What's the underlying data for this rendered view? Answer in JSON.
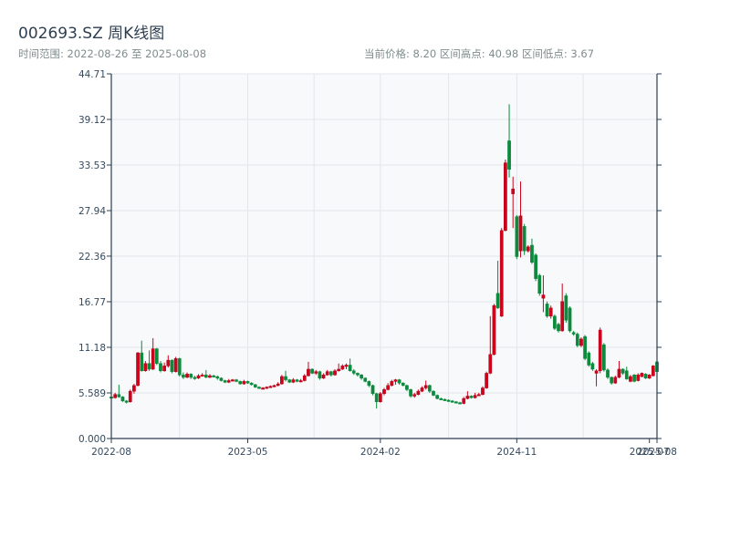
{
  "header": {
    "title": "002693.SZ 周K线图",
    "range": "时间范围: 2022-08-26 至 2025-08-08",
    "stats": "当前价格: 8.20  区间高点: 40.98  区间低点: 3.67"
  },
  "colors": {
    "up": "#d0021b",
    "down": "#0b8a3c",
    "plot_bg": "#f7f9fb",
    "grid": "#e3e6ea",
    "axis": "#2c3e50"
  },
  "chart_data": {
    "type": "candlestick",
    "title": "002693.SZ 周K线图",
    "ylim": [
      0,
      44.71
    ],
    "y_ticks": [
      "0.000",
      "5.589",
      "11.18",
      "16.77",
      "22.36",
      "27.94",
      "33.53",
      "39.12",
      "44.71"
    ],
    "x_ticks": [
      {
        "label": "2022-08",
        "index": 0
      },
      {
        "label": "2023-05",
        "index": 36
      },
      {
        "label": "2024-02",
        "index": 71
      },
      {
        "label": "2024-11",
        "index": 107
      },
      {
        "label": "2025-07",
        "index": 142
      },
      {
        "label": "2025-08",
        "index": 144
      }
    ],
    "grid": true,
    "candle_fields": [
      "open",
      "close",
      "low",
      "high"
    ],
    "candles": [
      [
        5.1,
        5.0,
        4.9,
        5.3
      ],
      [
        5.0,
        5.4,
        4.9,
        5.6
      ],
      [
        5.4,
        5.1,
        5.0,
        6.6
      ],
      [
        5.1,
        4.6,
        4.5,
        5.2
      ],
      [
        4.6,
        4.5,
        4.3,
        4.7
      ],
      [
        4.5,
        5.8,
        4.4,
        6.0
      ],
      [
        5.8,
        6.5,
        5.5,
        6.7
      ],
      [
        6.5,
        10.5,
        6.4,
        10.6
      ],
      [
        10.5,
        8.3,
        8.2,
        12.0
      ],
      [
        8.3,
        9.2,
        8.2,
        9.5
      ],
      [
        9.2,
        8.5,
        8.3,
        10.8
      ],
      [
        8.5,
        11.0,
        8.4,
        12.3
      ],
      [
        11.0,
        9.2,
        9.0,
        11.1
      ],
      [
        9.2,
        8.3,
        8.1,
        9.5
      ],
      [
        8.3,
        8.9,
        8.2,
        9.3
      ],
      [
        8.9,
        9.6,
        8.7,
        10.2
      ],
      [
        9.6,
        8.2,
        8.0,
        9.7
      ],
      [
        8.2,
        9.8,
        8.1,
        10.0
      ],
      [
        9.8,
        7.8,
        7.6,
        9.9
      ],
      [
        7.8,
        7.5,
        7.3,
        8.1
      ],
      [
        7.5,
        7.9,
        7.4,
        8.1
      ],
      [
        7.9,
        7.5,
        7.3,
        8.0
      ],
      [
        7.5,
        7.4,
        7.2,
        7.7
      ],
      [
        7.4,
        7.7,
        7.3,
        7.9
      ],
      [
        7.7,
        7.8,
        7.6,
        8.0
      ],
      [
        7.8,
        7.5,
        7.4,
        8.4
      ],
      [
        7.5,
        7.7,
        7.4,
        7.9
      ],
      [
        7.7,
        7.6,
        7.5,
        7.8
      ],
      [
        7.6,
        7.4,
        7.2,
        7.7
      ],
      [
        7.4,
        7.1,
        7.0,
        7.5
      ],
      [
        7.1,
        6.9,
        6.8,
        7.2
      ],
      [
        6.9,
        7.1,
        6.8,
        7.3
      ],
      [
        7.1,
        7.2,
        7.0,
        7.3
      ],
      [
        7.2,
        7.0,
        6.9,
        7.3
      ],
      [
        7.0,
        6.7,
        6.6,
        7.1
      ],
      [
        6.7,
        7.0,
        6.6,
        7.2
      ],
      [
        7.0,
        6.8,
        6.7,
        7.1
      ],
      [
        6.8,
        6.6,
        6.5,
        6.9
      ],
      [
        6.6,
        6.3,
        6.2,
        6.7
      ],
      [
        6.3,
        6.2,
        6.1,
        6.4
      ],
      [
        6.2,
        6.2,
        6.1,
        6.3
      ],
      [
        6.2,
        6.3,
        6.1,
        6.4
      ],
      [
        6.3,
        6.4,
        6.2,
        6.5
      ],
      [
        6.4,
        6.5,
        6.3,
        6.6
      ],
      [
        6.5,
        6.7,
        6.4,
        6.9
      ],
      [
        6.7,
        7.6,
        6.6,
        7.8
      ],
      [
        7.6,
        7.2,
        7.0,
        8.3
      ],
      [
        7.2,
        6.9,
        6.8,
        7.3
      ],
      [
        6.9,
        7.2,
        6.8,
        7.4
      ],
      [
        7.2,
        7.0,
        6.9,
        7.3
      ],
      [
        7.0,
        7.1,
        6.9,
        7.3
      ],
      [
        7.1,
        7.7,
        7.0,
        7.9
      ],
      [
        7.7,
        8.5,
        7.6,
        9.4
      ],
      [
        8.5,
        8.0,
        7.9,
        8.6
      ],
      [
        8.0,
        8.2,
        7.8,
        8.4
      ],
      [
        8.2,
        7.4,
        7.2,
        8.3
      ],
      [
        7.4,
        7.8,
        7.3,
        8.0
      ],
      [
        7.8,
        8.2,
        7.7,
        8.4
      ],
      [
        8.2,
        7.8,
        7.6,
        8.3
      ],
      [
        7.8,
        8.3,
        7.7,
        8.5
      ],
      [
        8.3,
        8.5,
        8.2,
        9.2
      ],
      [
        8.5,
        8.9,
        8.4,
        9.1
      ],
      [
        8.9,
        9.0,
        8.5,
        9.2
      ],
      [
        9.0,
        8.3,
        8.2,
        9.8
      ],
      [
        8.3,
        8.0,
        7.8,
        8.5
      ],
      [
        8.0,
        7.8,
        7.6,
        8.1
      ],
      [
        7.8,
        7.4,
        7.2,
        7.9
      ],
      [
        7.4,
        7.0,
        6.9,
        7.5
      ],
      [
        7.0,
        6.5,
        6.3,
        7.1
      ],
      [
        6.5,
        5.5,
        5.3,
        6.6
      ],
      [
        5.5,
        4.5,
        3.67,
        5.6
      ],
      [
        4.5,
        5.5,
        4.4,
        5.7
      ],
      [
        5.5,
        6.0,
        5.3,
        6.2
      ],
      [
        6.0,
        6.5,
        5.9,
        6.8
      ],
      [
        6.5,
        7.0,
        6.4,
        7.2
      ],
      [
        7.0,
        7.2,
        6.6,
        7.3
      ],
      [
        7.2,
        6.8,
        6.6,
        7.3
      ],
      [
        6.8,
        6.5,
        6.4,
        6.9
      ],
      [
        6.5,
        6.0,
        5.8,
        6.6
      ],
      [
        6.0,
        5.2,
        5.0,
        6.1
      ],
      [
        5.2,
        5.4,
        5.0,
        5.6
      ],
      [
        5.4,
        5.8,
        5.3,
        6.0
      ],
      [
        5.8,
        6.2,
        5.7,
        6.4
      ],
      [
        6.2,
        6.5,
        6.0,
        7.1
      ],
      [
        6.5,
        5.8,
        5.6,
        6.6
      ],
      [
        5.8,
        5.3,
        5.2,
        5.9
      ],
      [
        5.3,
        4.9,
        4.8,
        5.4
      ],
      [
        4.9,
        4.8,
        4.7,
        5.0
      ],
      [
        4.8,
        4.7,
        4.6,
        4.9
      ],
      [
        4.7,
        4.6,
        4.5,
        4.8
      ],
      [
        4.6,
        4.5,
        4.4,
        4.7
      ],
      [
        4.5,
        4.4,
        4.3,
        4.6
      ],
      [
        4.4,
        4.3,
        4.2,
        4.5
      ],
      [
        4.3,
        4.9,
        4.2,
        5.1
      ],
      [
        4.9,
        5.2,
        4.8,
        5.8
      ],
      [
        5.2,
        5.0,
        4.9,
        5.3
      ],
      [
        5.0,
        5.3,
        4.9,
        5.6
      ],
      [
        5.3,
        5.4,
        5.2,
        5.6
      ],
      [
        5.4,
        6.2,
        5.3,
        6.4
      ],
      [
        6.2,
        8.0,
        6.1,
        8.2
      ],
      [
        8.0,
        10.3,
        7.9,
        15.0
      ],
      [
        10.3,
        16.3,
        10.2,
        16.5
      ],
      [
        17.8,
        16.0,
        15.9,
        21.8
      ],
      [
        15.0,
        25.5,
        14.9,
        25.8
      ],
      [
        25.5,
        33.8,
        25.4,
        34.2
      ],
      [
        36.5,
        33.0,
        32.0,
        40.98
      ],
      [
        30.0,
        30.6,
        25.8,
        32.1
      ],
      [
        27.2,
        22.3,
        22.0,
        27.4
      ],
      [
        23.0,
        27.3,
        22.2,
        31.5
      ],
      [
        26.0,
        23.0,
        22.5,
        26.3
      ],
      [
        23.0,
        23.5,
        22.8,
        23.7
      ],
      [
        23.7,
        21.6,
        21.4,
        24.5
      ],
      [
        22.5,
        19.6,
        19.3,
        22.7
      ],
      [
        20.0,
        17.8,
        17.5,
        20.2
      ],
      [
        17.2,
        17.6,
        15.5,
        20.0
      ],
      [
        16.5,
        15.0,
        14.8,
        16.8
      ],
      [
        15.0,
        16.0,
        14.7,
        16.3
      ],
      [
        15.0,
        13.5,
        13.3,
        15.2
      ],
      [
        14.0,
        13.2,
        13.0,
        14.2
      ],
      [
        13.2,
        16.8,
        13.1,
        19.0
      ],
      [
        17.5,
        14.5,
        14.2,
        17.8
      ],
      [
        16.0,
        13.2,
        13.0,
        16.2
      ],
      [
        13.0,
        12.8,
        12.6,
        13.2
      ],
      [
        12.8,
        11.4,
        11.2,
        13.0
      ],
      [
        11.4,
        12.2,
        11.2,
        12.4
      ],
      [
        12.5,
        9.8,
        9.6,
        12.7
      ],
      [
        10.5,
        9.0,
        8.8,
        10.7
      ],
      [
        9.2,
        8.5,
        8.3,
        9.4
      ],
      [
        8.0,
        8.3,
        6.4,
        8.5
      ],
      [
        8.3,
        13.3,
        8.0,
        13.6
      ],
      [
        11.5,
        8.4,
        8.2,
        11.7
      ],
      [
        8.4,
        7.5,
        7.3,
        8.6
      ],
      [
        7.5,
        6.8,
        6.6,
        7.6
      ],
      [
        6.8,
        7.5,
        6.7,
        7.7
      ],
      [
        7.5,
        8.5,
        7.4,
        9.5
      ],
      [
        8.5,
        8.0,
        7.8,
        8.6
      ],
      [
        8.3,
        7.3,
        7.2,
        8.8
      ],
      [
        7.0,
        7.6,
        6.9,
        7.8
      ],
      [
        7.8,
        7.0,
        6.9,
        7.9
      ],
      [
        7.1,
        7.8,
        7.0,
        8.0
      ],
      [
        7.6,
        8.0,
        7.5,
        8.1
      ],
      [
        7.9,
        7.4,
        7.3,
        8.0
      ],
      [
        7.4,
        7.8,
        7.3,
        7.9
      ],
      [
        7.7,
        8.9,
        7.6,
        9.0
      ],
      [
        9.4,
        8.2,
        8.1,
        9.6
      ]
    ]
  }
}
